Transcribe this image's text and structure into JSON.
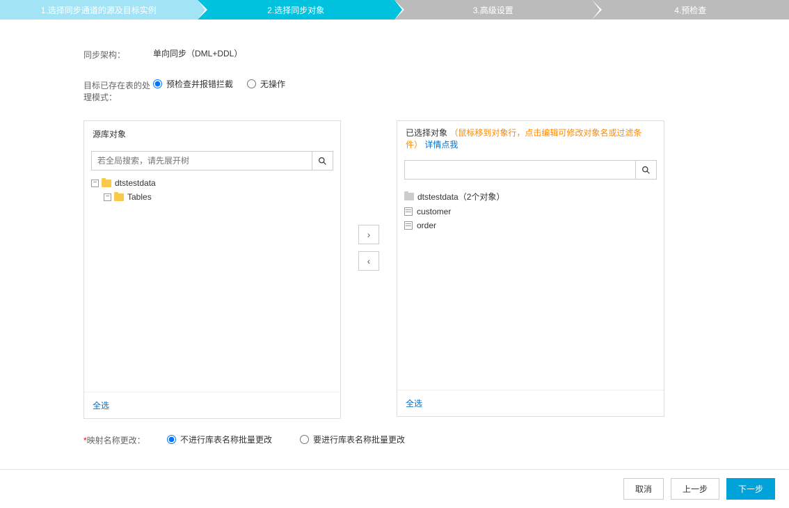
{
  "steps": {
    "s1": "1.选择同步通道的源及目标实例",
    "s2": "2.选择同步对象",
    "s3": "3.高级设置",
    "s4": "4.预检查"
  },
  "syncArch": {
    "label": "同步架构：",
    "value": "单向同步（DML+DDL）"
  },
  "targetMode": {
    "label": "目标已存在表的处理模式：",
    "opt1": "预检查并报错拦截",
    "opt2": "无操作"
  },
  "sourcePanel": {
    "title": "源库对象",
    "searchPlaceholder": "若全局搜索，请先展开树",
    "node1": "dtstestdata",
    "node2": "Tables",
    "selectAll": "全选"
  },
  "targetPanel": {
    "title": "已选择对象",
    "hint": "（鼠标移到对象行，点击编辑可修改对象名或过滤条件）",
    "linkText": "详情点我",
    "node1": "dtstestdata（2个对象）",
    "node2": "customer",
    "node3": "order",
    "selectAll": "全选"
  },
  "mapping": {
    "label": "映射名称更改：",
    "opt1": "不进行库表名称批量更改",
    "opt2": "要进行库表名称批量更改"
  },
  "footer": {
    "cancel": "取消",
    "prev": "上一步",
    "next": "下一步"
  }
}
